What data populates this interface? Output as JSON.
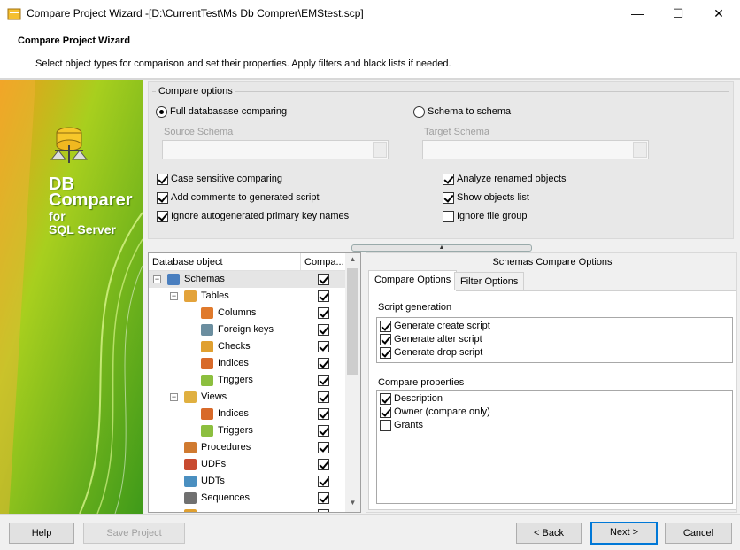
{
  "window": {
    "title": "Compare Project Wizard -[D:\\CurrentTest\\Ms Db Comprer\\EMStest.scp]",
    "minimize": "—",
    "maximize": "☐",
    "close": "✕"
  },
  "header": {
    "title": "Compare Project Wizard",
    "subtitle": "Select object types for comparison and set their properties. Apply filters and black lists if needed."
  },
  "brand": {
    "line1": "DB",
    "line2": "Comparer",
    "line3": "for",
    "line4": "SQL Server",
    "accent_color": "#7dc414"
  },
  "compare_options": {
    "legend": "Compare options",
    "full_db_label": "Full databasase comparing",
    "full_db_selected": true,
    "schema_to_schema_label": "Schema to schema",
    "schema_to_schema_selected": false,
    "source_schema_label": "Source Schema",
    "target_schema_label": "Target Schema",
    "source_schema_value": "",
    "target_schema_value": "",
    "combo_button": "...",
    "checks": [
      {
        "label": "Case sensitive comparing",
        "checked": true
      },
      {
        "label": "Add comments to generated script",
        "checked": true
      },
      {
        "label": "Ignore autogenerated primary key names",
        "checked": true
      },
      {
        "label": "Analyze renamed objects",
        "checked": true
      },
      {
        "label": "Show objects list",
        "checked": true
      },
      {
        "label": "Ignore file group",
        "checked": false
      }
    ]
  },
  "splitter": {
    "icon": "▲"
  },
  "tree": {
    "col_object": "Database object",
    "col_compare": "Compa...",
    "expander_minus": "−",
    "rows": [
      {
        "label": "Schemas",
        "checked": true,
        "icon": "schema-icon",
        "color": "#4a7fbf"
      },
      {
        "label": "Tables",
        "checked": true,
        "icon": "table-icon",
        "color": "#e3a33b"
      },
      {
        "label": "Columns",
        "checked": true,
        "icon": "column-icon",
        "color": "#e07a2c"
      },
      {
        "label": "Foreign keys",
        "checked": true,
        "icon": "foreign-key-icon",
        "color": "#6b8e9f"
      },
      {
        "label": "Checks",
        "checked": true,
        "icon": "check-icon",
        "color": "#e0a030"
      },
      {
        "label": "Indices",
        "checked": true,
        "icon": "index-icon",
        "color": "#d86a2a"
      },
      {
        "label": "Triggers",
        "checked": true,
        "icon": "trigger-icon",
        "color": "#8cbf3f"
      },
      {
        "label": "Views",
        "checked": true,
        "icon": "view-icon",
        "color": "#e0b040"
      },
      {
        "label": "Indices",
        "checked": true,
        "icon": "index-icon",
        "color": "#d86a2a"
      },
      {
        "label": "Triggers",
        "checked": true,
        "icon": "trigger-icon",
        "color": "#8cbf3f"
      },
      {
        "label": "Procedures",
        "checked": true,
        "icon": "procedure-icon",
        "color": "#d07a30"
      },
      {
        "label": "UDFs",
        "checked": true,
        "icon": "udf-icon",
        "color": "#c84a30"
      },
      {
        "label": "UDTs",
        "checked": true,
        "icon": "udt-icon",
        "color": "#4a8fc0"
      },
      {
        "label": "Sequences",
        "checked": true,
        "icon": "sequence-icon",
        "color": "#707070"
      }
    ],
    "scroll_up": "▲",
    "scroll_down": "▼"
  },
  "schemas_panel": {
    "title": "Schemas Compare Options",
    "tabs": [
      "Compare Options",
      "Filter Options"
    ],
    "script_generation_title": "Script generation",
    "script_generation": [
      {
        "label": "Generate create script",
        "checked": true
      },
      {
        "label": "Generate alter script",
        "checked": true
      },
      {
        "label": "Generate drop script",
        "checked": true
      }
    ],
    "compare_properties_title": "Compare properties",
    "compare_properties": [
      {
        "label": "Description",
        "checked": true
      },
      {
        "label": "Owner (compare only)",
        "checked": true
      },
      {
        "label": "Grants",
        "checked": false
      }
    ]
  },
  "buttons": {
    "help": "Help",
    "save_project": "Save Project",
    "back": "< Back",
    "next": "Next >",
    "cancel": "Cancel"
  }
}
